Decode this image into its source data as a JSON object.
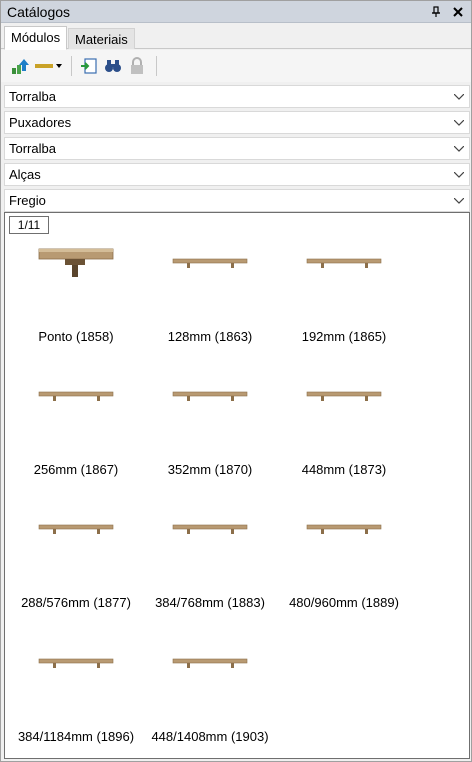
{
  "window": {
    "title": "Catálogos",
    "pin_icon": "pin-icon",
    "close_icon": "close-icon"
  },
  "tabs": [
    {
      "label": "Módulos",
      "active": true
    },
    {
      "label": "Materiais",
      "active": false
    }
  ],
  "toolbar": [
    "load-module-icon",
    "line-style-dropdown-icon",
    "insert-icon",
    "search-binoculars-icon",
    "lock-icon"
  ],
  "filters": [
    "Torralba",
    "Puxadores",
    "Torralba",
    "Alças",
    "Fregio"
  ],
  "pager": "1/11",
  "items": [
    {
      "label": "Ponto (1858)",
      "kind": "knob"
    },
    {
      "label": "128mm (1863)",
      "kind": "bar"
    },
    {
      "label": "192mm (1865)",
      "kind": "bar"
    },
    {
      "label": "256mm (1867)",
      "kind": "bar"
    },
    {
      "label": "352mm (1870)",
      "kind": "bar"
    },
    {
      "label": "448mm (1873)",
      "kind": "bar"
    },
    {
      "label": "288/576mm (1877)",
      "kind": "bar"
    },
    {
      "label": "384/768mm (1883)",
      "kind": "bar"
    },
    {
      "label": "480/960mm (1889)",
      "kind": "bar"
    },
    {
      "label": "384/1184mm (1896)",
      "kind": "bar"
    },
    {
      "label": "448/1408mm (1903)",
      "kind": "bar"
    }
  ],
  "colors": {
    "wood": "#b89a72",
    "wood_dark": "#8c6f4a",
    "titlebar": "#cfd5de"
  }
}
